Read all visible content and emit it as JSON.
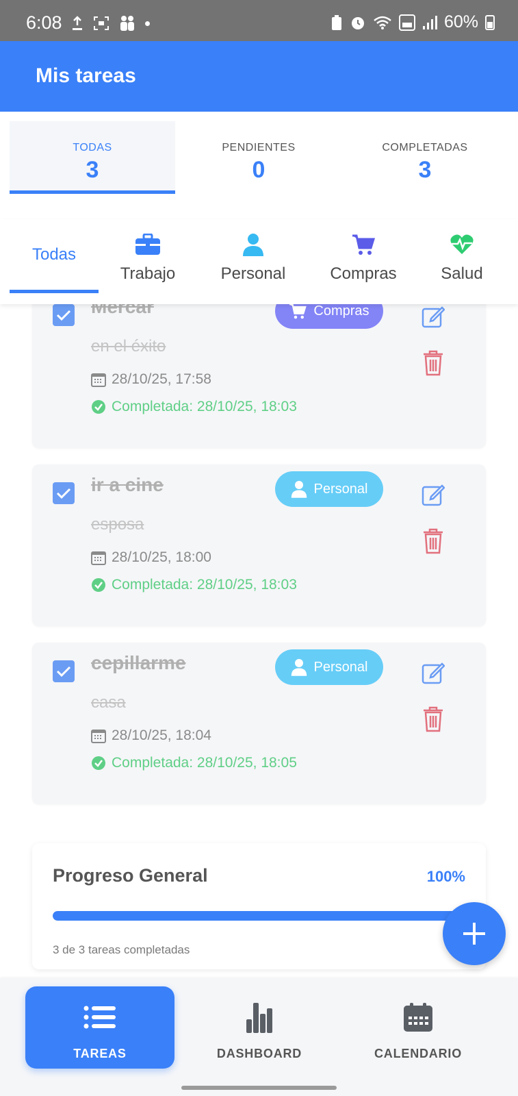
{
  "status_bar": {
    "time": "6:08",
    "battery": "60%"
  },
  "app": {
    "title": "Mis tareas"
  },
  "stats": [
    {
      "label": "TODAS",
      "count": "3",
      "active": true
    },
    {
      "label": "PENDIENTES",
      "count": "0",
      "active": false
    },
    {
      "label": "COMPLETADAS",
      "count": "3",
      "active": false
    }
  ],
  "categories": [
    {
      "label": "Todas",
      "icon": "none",
      "active": true
    },
    {
      "label": "Trabajo",
      "icon": "briefcase-icon",
      "color": "#3a80f8"
    },
    {
      "label": "Personal",
      "icon": "person-icon",
      "color": "#37b9f2"
    },
    {
      "label": "Compras",
      "icon": "cart-icon",
      "color": "#5b5ce8"
    },
    {
      "label": "Salud",
      "icon": "heartbeat-icon",
      "color": "#2ecc71"
    }
  ],
  "tasks": [
    {
      "title": "Mercar",
      "description": "en el éxito",
      "date": "28/10/25, 17:58",
      "completed": "Completada: 28/10/25, 18:03",
      "category": "Compras",
      "category_color": "#8384f6"
    },
    {
      "title": "ir a cine",
      "description": "esposa",
      "date": "28/10/25, 18:00",
      "completed": "Completada: 28/10/25, 18:03",
      "category": "Personal",
      "category_color": "#66cdf7"
    },
    {
      "title": "cepillarme",
      "description": "casa",
      "date": "28/10/25, 18:04",
      "completed": "Completada: 28/10/25, 18:05",
      "category": "Personal",
      "category_color": "#66cdf7"
    }
  ],
  "progress": {
    "title": "Progreso General",
    "percent_label": "100%",
    "fraction": 1.0,
    "subtitle": "3 de 3 tareas completadas"
  },
  "bottom_nav": [
    {
      "label": "TAREAS",
      "icon": "list-icon",
      "active": true
    },
    {
      "label": "DASHBOARD",
      "icon": "bar-chart-icon",
      "active": false
    },
    {
      "label": "CALENDARIO",
      "icon": "calendar-icon",
      "active": false
    }
  ],
  "colors": {
    "primary": "#3a80f8",
    "success": "#5fcf86",
    "danger": "#e2707d",
    "card_bg": "#f5f6f8"
  }
}
